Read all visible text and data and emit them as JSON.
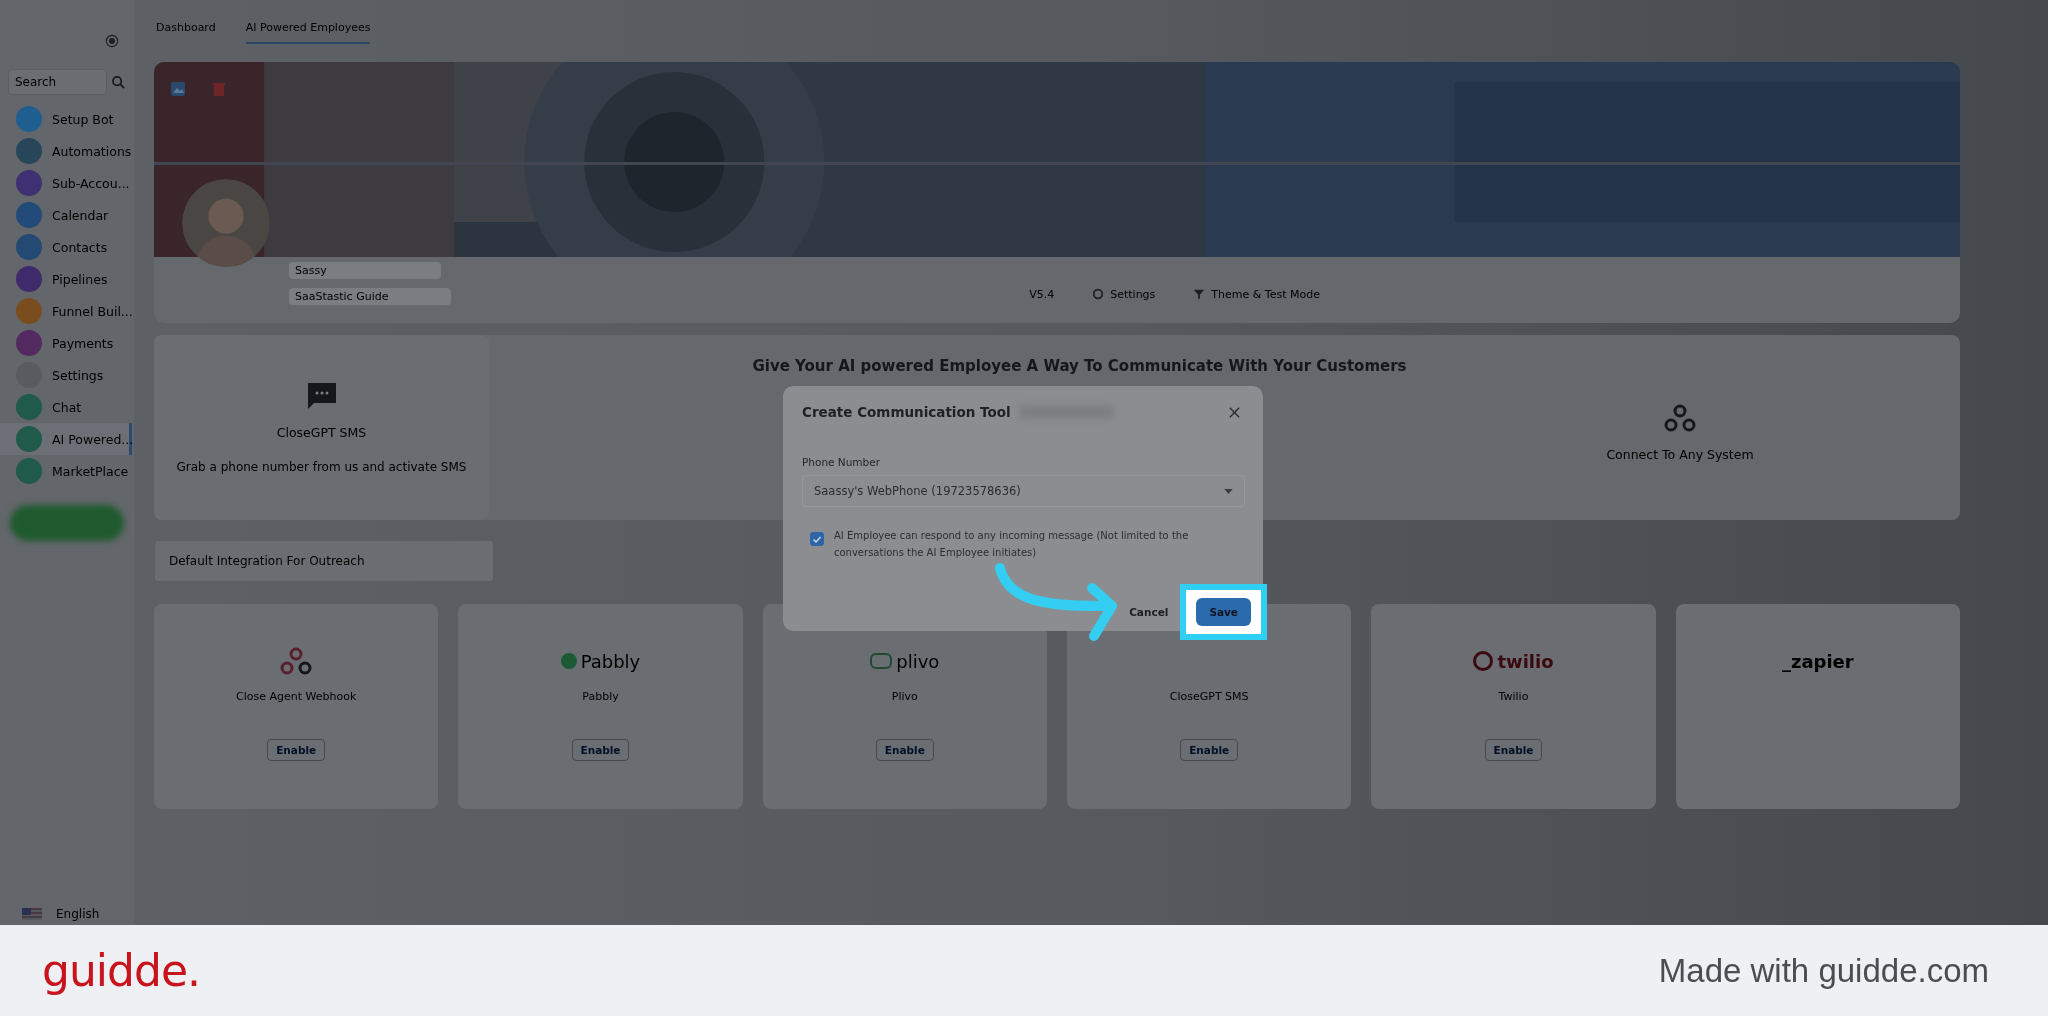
{
  "sidebar": {
    "search": {
      "placeholder": "Search"
    },
    "items": [
      {
        "label": "Setup Bot",
        "color": "#1f5f8f",
        "selected": false
      },
      {
        "label": "Automations",
        "color": "#27465a",
        "selected": false
      },
      {
        "label": "Sub-Accou...",
        "color": "#3f2f73",
        "selected": false
      },
      {
        "label": "Calendar",
        "color": "#234b7a",
        "selected": false
      },
      {
        "label": "Contacts",
        "color": "#244a74",
        "selected": false
      },
      {
        "label": "Pipelines",
        "color": "#3f2a6b",
        "selected": false
      },
      {
        "label": "Funnel Buil...",
        "color": "#7a4d1e",
        "selected": false
      },
      {
        "label": "Payments",
        "color": "#532a60",
        "selected": false
      },
      {
        "label": "Settings",
        "color": "#585c60",
        "selected": false
      },
      {
        "label": "Chat",
        "color": "#1f5a4a",
        "selected": false
      },
      {
        "label": "AI Powered...",
        "color": "#1f5a4a",
        "selected": true
      },
      {
        "label": "MarketPlace",
        "color": "#1f5a4a",
        "selected": false
      }
    ],
    "language": "English"
  },
  "tabs": [
    {
      "label": "Dashboard",
      "selected": false
    },
    {
      "label": "AI Powered Employees",
      "selected": true
    }
  ],
  "profile": {
    "name": "Sassy",
    "subtitle": "SaaStastic Guide"
  },
  "toolbar": [
    {
      "kind": "text",
      "label": "V5.4"
    },
    {
      "kind": "settings",
      "label": "Settings"
    },
    {
      "kind": "filter",
      "label": "Theme & Test Mode"
    }
  ],
  "section": {
    "heading": "Give Your AI powered Employee A Way To Communicate With Your Customers",
    "sms": {
      "title": "CloseGPT SMS",
      "description": "Grab a phone number from us and activate SMS"
    },
    "connect": {
      "title": "Connect To Any System"
    }
  },
  "default_integration": {
    "placeholder": "Default Integration For Outreach"
  },
  "integrations": [
    {
      "kind": "webhook",
      "name": "Close Agent Webhook",
      "button": "Enable"
    },
    {
      "kind": "pabbly",
      "logo": "Pabbly",
      "name": "Pabbly",
      "button": "Enable"
    },
    {
      "kind": "plivo",
      "logo": "plivo",
      "name": "Plivo",
      "button": "Enable"
    },
    {
      "kind": "none",
      "name": "CloseGPT SMS",
      "button": "Enable"
    },
    {
      "kind": "twilio",
      "logo": "twilio",
      "name": "Twilio",
      "button": "Enable"
    },
    {
      "kind": "zapier",
      "logo": "_zapier"
    }
  ],
  "dialog": {
    "title": "Create Communication Tool",
    "field_label": "Phone Number",
    "phone": "Saassy's WebPhone (19723578636)",
    "respond_any": {
      "checked": true,
      "label": "AI Employee can respond to any incoming message (Not limited to the conversations the AI Employee initiates)"
    },
    "cancel": "Cancel",
    "save": "Save"
  },
  "footer": {
    "brand": "guidde.",
    "tagline": "Made with guidde.com"
  }
}
